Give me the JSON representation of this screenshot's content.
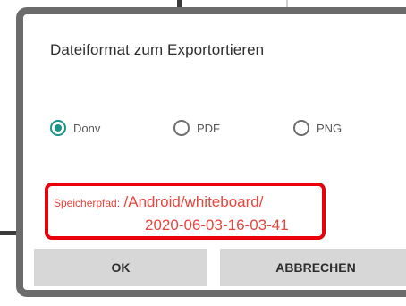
{
  "dialog": {
    "title": "Dateiformat zum Exportortieren",
    "format_options": [
      {
        "label": "Donv",
        "checked": true
      },
      {
        "label": "PDF",
        "checked": false
      },
      {
        "label": "PNG",
        "checked": false
      }
    ],
    "save_path": {
      "label": "Speicherpfad:",
      "value_line1": "/Android/whiteboard/",
      "value_line2": "2020-06-03-16-03-41"
    },
    "buttons": {
      "ok_label": "OK",
      "cancel_label": "ABBRECHEN"
    }
  },
  "colors": {
    "accent_radio": "#1a9488",
    "highlight_border": "#e8000b",
    "path_text": "#e8453c",
    "button_bg": "#d7d7d7"
  }
}
